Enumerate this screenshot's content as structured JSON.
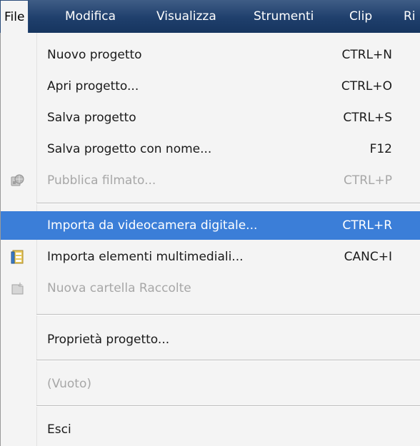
{
  "menubar": {
    "items": [
      {
        "label": "File"
      },
      {
        "label": "Modifica"
      },
      {
        "label": "Visualizza"
      },
      {
        "label": "Strumenti"
      },
      {
        "label": "Clip"
      },
      {
        "label": "Ri"
      }
    ]
  },
  "file_menu": {
    "items": [
      {
        "label": "Nuovo progetto",
        "shortcut": "CTRL+N",
        "enabled": true
      },
      {
        "label": "Apri progetto...",
        "shortcut": "CTRL+O",
        "enabled": true
      },
      {
        "label": "Salva progetto",
        "shortcut": "CTRL+S",
        "enabled": true
      },
      {
        "label": "Salva progetto con nome...",
        "shortcut": "F12",
        "enabled": true
      },
      {
        "label": "Pubblica filmato...",
        "shortcut": "CTRL+P",
        "enabled": false,
        "icon": "publish-movie-icon"
      },
      {
        "label": "Importa da videocamera digitale...",
        "shortcut": "CTRL+R",
        "enabled": true,
        "highlighted": true
      },
      {
        "label": "Importa elementi multimediali...",
        "shortcut": "CANC+I",
        "enabled": true,
        "icon": "import-media-icon"
      },
      {
        "label": "Nuova cartella Raccolte",
        "shortcut": "",
        "enabled": false,
        "icon": "new-collection-folder-icon"
      },
      {
        "label": "Proprietà progetto...",
        "shortcut": "",
        "enabled": true
      },
      {
        "label": "(Vuoto)",
        "shortcut": "",
        "enabled": false
      },
      {
        "label": "Esci",
        "shortcut": "",
        "enabled": true
      }
    ]
  },
  "colors": {
    "menubar": "#1f3f6c",
    "highlight": "#3b7ed8",
    "disabled_text": "#a7a7a7"
  }
}
